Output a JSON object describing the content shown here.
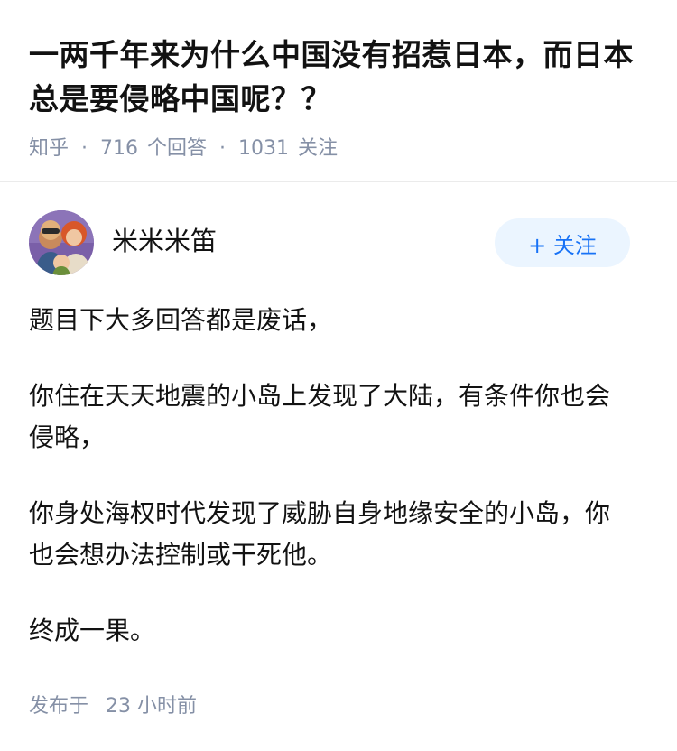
{
  "question": {
    "title": "一两千年来为什么中国没有招惹日本，而日本总是要侵略中国呢？？",
    "source": "知乎",
    "answer_count": "716",
    "answer_label": "个回答",
    "follower_count": "1031",
    "follower_label": "关注"
  },
  "answer": {
    "author_name": "米米米笛",
    "follow_button": "+ 关注",
    "paragraphs": [
      "题目下大多回答都是废话，",
      "你住在天天地震的小岛上发现了大陆，有条件你也会侵略，",
      "你身处海权时代发现了威胁自身地缘安全的小岛，你也会想办法控制或干死他。",
      "终成一果。"
    ],
    "publish_label": "发布于",
    "publish_time": "23 小时前"
  },
  "colors": {
    "text": "#121212",
    "meta": "#8590a6",
    "accent": "#1772f6",
    "button_bg": "#ebf5ff"
  }
}
